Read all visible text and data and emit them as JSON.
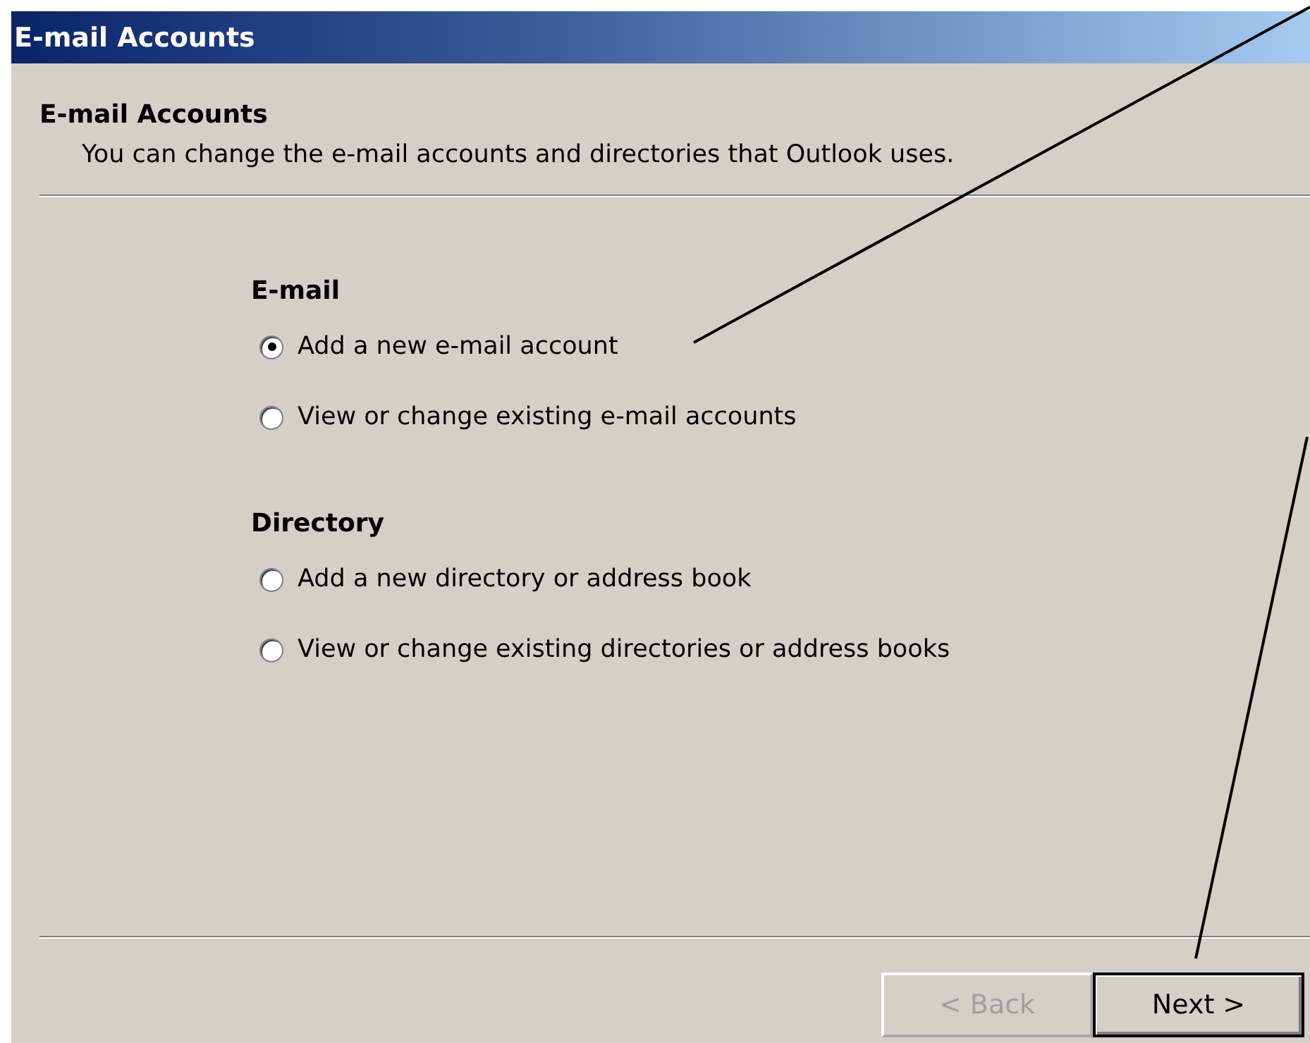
{
  "window": {
    "title": "E-mail Accounts"
  },
  "header": {
    "title": "E-mail Accounts",
    "subtitle": "You can change the e-mail accounts and directories that Outlook uses."
  },
  "groups": [
    {
      "label": "E-mail",
      "options": [
        {
          "label": "Add a new e-mail account",
          "selected": true
        },
        {
          "label": "View or change existing e-mail accounts",
          "selected": false
        }
      ]
    },
    {
      "label": "Directory",
      "options": [
        {
          "label": "Add a new directory or address book",
          "selected": false
        },
        {
          "label": "View or change existing directories or address books",
          "selected": false
        }
      ]
    }
  ],
  "buttons": [
    {
      "label": "< Back",
      "disabled": true,
      "default": false
    },
    {
      "label": "Next >",
      "disabled": false,
      "default": true
    }
  ]
}
